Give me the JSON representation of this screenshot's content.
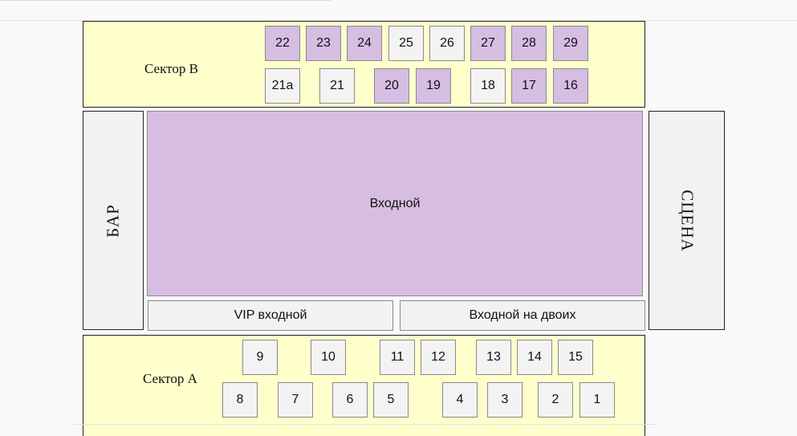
{
  "sector_b": {
    "label": "Сектор B",
    "row_top": [
      {
        "label": "22",
        "status": "taken"
      },
      {
        "label": "23",
        "status": "taken"
      },
      {
        "label": "24",
        "status": "taken"
      },
      {
        "label": "25",
        "status": "free"
      },
      {
        "label": "26",
        "status": "free"
      },
      {
        "label": "27",
        "status": "taken"
      },
      {
        "label": "28",
        "status": "taken"
      },
      {
        "label": "29",
        "status": "taken"
      }
    ],
    "row_bottom": [
      {
        "label": "21a",
        "status": "free"
      },
      {
        "label": "21",
        "status": "free"
      },
      {
        "label": "20",
        "status": "taken"
      },
      {
        "label": "19",
        "status": "taken"
      },
      {
        "label": "18",
        "status": "free"
      },
      {
        "label": "17",
        "status": "taken"
      },
      {
        "label": "16",
        "status": "taken"
      }
    ]
  },
  "bar": {
    "label": "БАР"
  },
  "stage": {
    "label": "СЦЕНА"
  },
  "tickets": {
    "general": "Входной",
    "vip": "VIP входной",
    "double": "Входной на двоих"
  },
  "sector_a": {
    "label": "Сектор А",
    "row_top": [
      {
        "label": "9",
        "status": "free"
      },
      {
        "label": "10",
        "status": "free"
      },
      {
        "label": "11",
        "status": "free"
      },
      {
        "label": "12",
        "status": "free"
      },
      {
        "label": "13",
        "status": "free"
      },
      {
        "label": "14",
        "status": "free"
      },
      {
        "label": "15",
        "status": "free"
      }
    ],
    "row_bottom": [
      {
        "label": "8",
        "status": "free"
      },
      {
        "label": "7",
        "status": "free"
      },
      {
        "label": "6",
        "status": "free"
      },
      {
        "label": "5",
        "status": "free"
      },
      {
        "label": "4",
        "status": "free"
      },
      {
        "label": "3",
        "status": "free"
      },
      {
        "label": "2",
        "status": "free"
      },
      {
        "label": "1",
        "status": "free"
      }
    ]
  },
  "colors": {
    "sector_bg": "#ffffcc",
    "seat_taken": "#d6bde2",
    "seat_free": "#f3f3f3"
  }
}
